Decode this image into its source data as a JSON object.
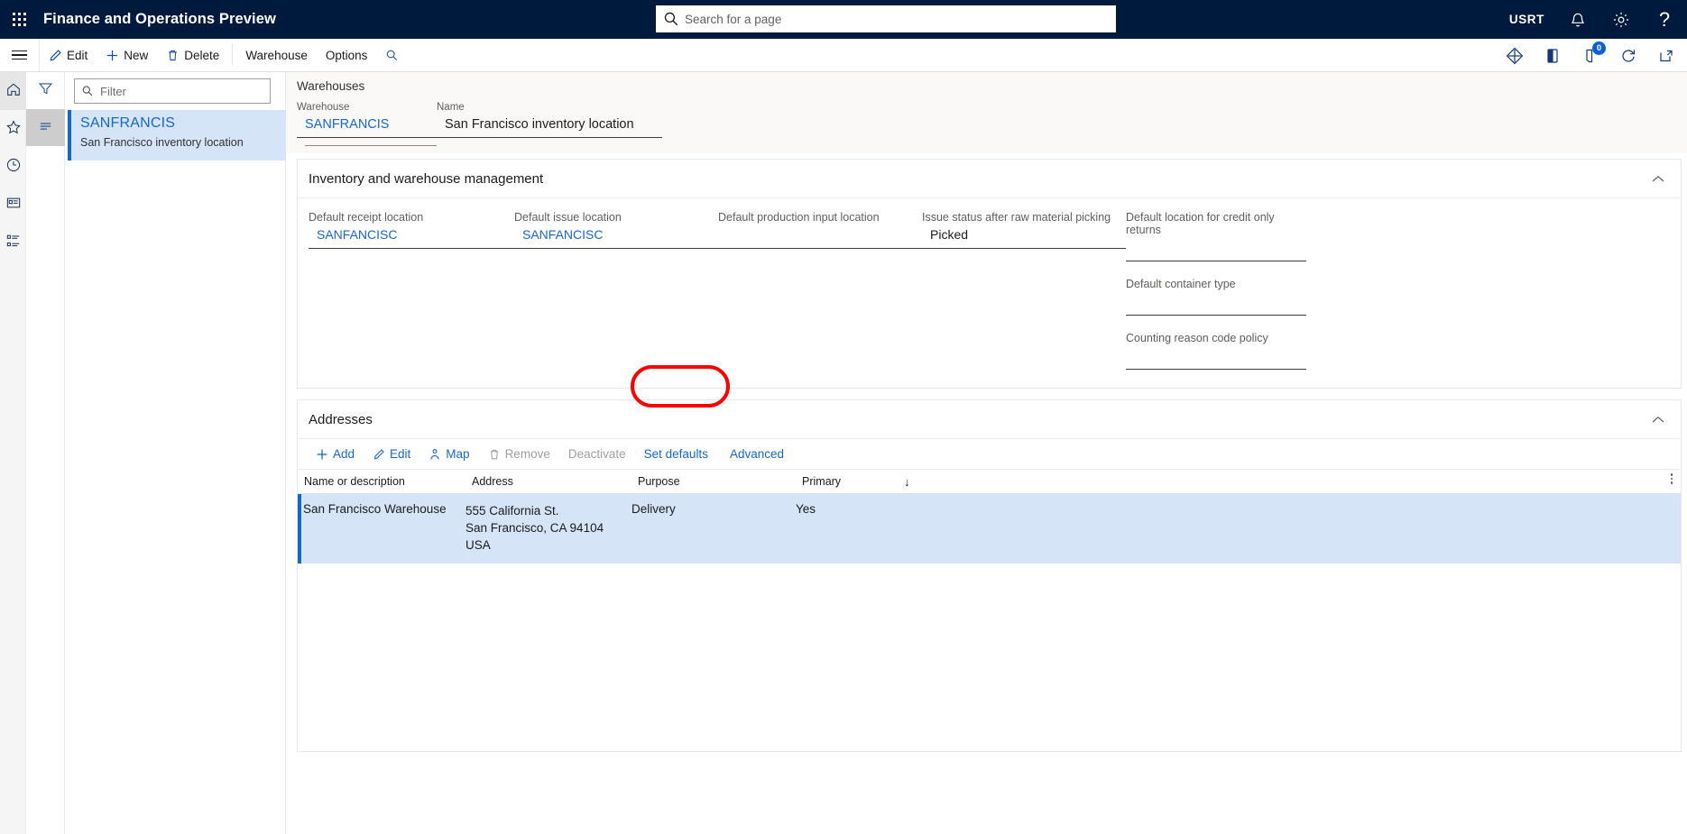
{
  "topbar": {
    "waffle_label": "app-launcher",
    "app_title": "Finance and Operations Preview",
    "search_placeholder": "Search for a page",
    "search_value": "",
    "user_initials": "USRT",
    "icons": [
      "bell-icon",
      "gear-icon",
      "question-icon"
    ]
  },
  "commandbar": {
    "items": [
      {
        "label": "Edit",
        "icon": "pencil-icon"
      },
      {
        "label": "New",
        "icon": "plus-icon"
      },
      {
        "label": "Delete",
        "icon": "trash-icon"
      },
      {
        "label": "Warehouse",
        "icon": ""
      },
      {
        "label": "Options",
        "icon": ""
      }
    ],
    "search_icon": "search-icon",
    "right_icons": [
      "attachments-icon",
      "open-in-office-icon",
      "chat-icon",
      "refresh-icon",
      "popout-icon"
    ],
    "chat_badge": "0"
  },
  "rail": {
    "items": [
      {
        "name": "home-icon"
      },
      {
        "name": "favorites-star-icon"
      },
      {
        "name": "recent-clock-icon"
      },
      {
        "name": "workspaces-icon"
      },
      {
        "name": "modules-list-icon"
      }
    ]
  },
  "listpane": {
    "tabs": [
      {
        "name": "filter-funnel-icon"
      },
      {
        "name": "list-lines-icon"
      }
    ],
    "filter_placeholder": "Filter",
    "filter_value": "",
    "records": [
      {
        "title": "SANFRANCIS",
        "subtitle": "San Francisco inventory location"
      }
    ]
  },
  "header": {
    "caption": "Warehouses",
    "fields": [
      {
        "label": "Warehouse",
        "value": "SANFRANCIS",
        "style": "link"
      },
      {
        "label": "Name",
        "value": "San Francisco inventory location",
        "style": "plain"
      }
    ]
  },
  "inventory_section": {
    "title": "Inventory and warehouse management",
    "collapse_icon": "chevron-up-icon",
    "columns": [
      {
        "fields": [
          {
            "label": "Default receipt location",
            "value": "SANFANCISC",
            "style": "link"
          }
        ]
      },
      {
        "fields": [
          {
            "label": "Default issue location",
            "value": "SANFANCISC",
            "style": "link"
          }
        ]
      },
      {
        "fields": [
          {
            "label": "Default production input location",
            "value": "",
            "style": "plain"
          }
        ]
      },
      {
        "fields": [
          {
            "label": "Issue status after raw material picking",
            "value": "Picked",
            "style": "plain"
          }
        ]
      },
      {
        "fields": [
          {
            "label": "Default location for credit only returns",
            "value": "",
            "style": "plain"
          },
          {
            "label": "Default container type",
            "value": "",
            "style": "plain"
          },
          {
            "label": "Counting reason code policy",
            "value": "",
            "style": "plain"
          }
        ]
      }
    ]
  },
  "addresses_section": {
    "title": "Addresses",
    "collapse_icon": "chevron-up-icon",
    "toolbar": [
      {
        "label": "Add",
        "icon": "plus-icon",
        "enabled": true
      },
      {
        "label": "Edit",
        "icon": "pencil-icon",
        "enabled": true
      },
      {
        "label": "Map",
        "icon": "map-pin-icon",
        "enabled": true
      },
      {
        "label": "Remove",
        "icon": "trash-icon",
        "enabled": false
      },
      {
        "label": "Deactivate",
        "icon": "",
        "enabled": false
      },
      {
        "label": "Set defaults",
        "icon": "",
        "enabled": true
      },
      {
        "label": "Advanced",
        "icon": "",
        "enabled": true
      }
    ],
    "grid": {
      "columns": [
        "Name or description",
        "Address",
        "Purpose",
        "Primary"
      ],
      "sort_indicator": "↓",
      "options_icon": "more-vertical-icon",
      "rows": [
        {
          "name": "San Francisco Warehouse",
          "address_lines": [
            "555 California St.",
            "San Francisco, CA 94104",
            "USA"
          ],
          "purpose": "Delivery",
          "primary": "Yes"
        }
      ]
    }
  },
  "annotation": {
    "target": "Advanced",
    "color": "#ff0000"
  },
  "colors": {
    "navy": "#001a3d",
    "link_blue": "#1668c8",
    "selection_blue": "#d6e4f7",
    "accent_bar": "#1668c8",
    "annotation_red": "#ff0000"
  }
}
